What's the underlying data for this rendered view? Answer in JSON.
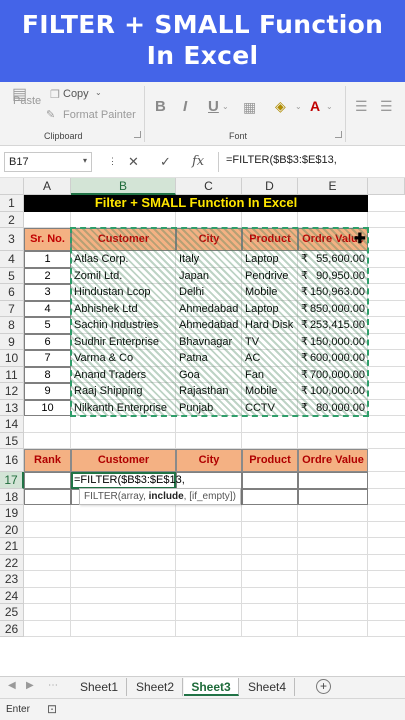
{
  "banner": {
    "line1": "FILTER + SMALL Function",
    "line2": "In Excel"
  },
  "ribbon": {
    "paste": "Paste",
    "copy": "Copy",
    "format_painter": "Format Painter",
    "clipboard_group": "Clipboard",
    "font_group": "Font",
    "bold": "B",
    "italic": "I",
    "underline": "U"
  },
  "formula_bar": {
    "name_box": "B17",
    "cancel": "✕",
    "enter": "✓",
    "fx": "fx",
    "formula": "=FILTER($B$3:$E$13,"
  },
  "columns": [
    "A",
    "B",
    "C",
    "D",
    "E"
  ],
  "rows": [
    "1",
    "2",
    "3",
    "4",
    "5",
    "6",
    "7",
    "8",
    "9",
    "10",
    "11",
    "12",
    "13",
    "14",
    "15",
    "16",
    "17",
    "18",
    "19",
    "20",
    "21",
    "22",
    "23",
    "24",
    "25",
    "26"
  ],
  "table": {
    "title": "Filter + SMALL Function In Excel",
    "headers": [
      "Sr. No.",
      "Customer",
      "City",
      "Product",
      "Ordre Value"
    ],
    "rows": [
      [
        "1",
        "Atlas Corp.",
        "Italy",
        "Laptop",
        "55,600.00"
      ],
      [
        "2",
        "Zomil Ltd.",
        "Japan",
        "Pendrive",
        "90,950.00"
      ],
      [
        "3",
        "Hindustan Lcop",
        "Delhi",
        "Mobile",
        "150,963.00"
      ],
      [
        "4",
        "Abhishek Ltd",
        "Ahmedabad",
        "Laptop",
        "850,000.00"
      ],
      [
        "5",
        "Sachin Industries",
        "Ahmedabad",
        "Hard Disk",
        "253,415.00"
      ],
      [
        "6",
        "Sudhir Enterprise",
        "Bhavnagar",
        "TV",
        "150,000.00"
      ],
      [
        "7",
        "Varma & Co",
        "Patna",
        "AC",
        "600,000.00"
      ],
      [
        "8",
        "Anand Traders",
        "Goa",
        "Fan",
        "700,000.00"
      ],
      [
        "9",
        "Raaj Shipping",
        "Rajasthan",
        "Mobile",
        "100,000.00"
      ],
      [
        "10",
        "Nilkanth Enterprise",
        "Punjab",
        "CCTV",
        "80,000.00"
      ]
    ],
    "currency": "₹"
  },
  "result": {
    "headers": [
      "Rank",
      "Customer",
      "City",
      "Product",
      "Ordre Value"
    ],
    "active_text": "=FILTER($B$3:$E$13,",
    "tooltip_fn": "FILTER(array, ",
    "tooltip_bold": "include",
    "tooltip_rest": ", [if_empty])"
  },
  "sheets": {
    "tabs": [
      "Sheet1",
      "Sheet2",
      "Sheet3",
      "Sheet4"
    ],
    "active": "Sheet3",
    "add": "+"
  },
  "status": {
    "mode": "Enter"
  }
}
